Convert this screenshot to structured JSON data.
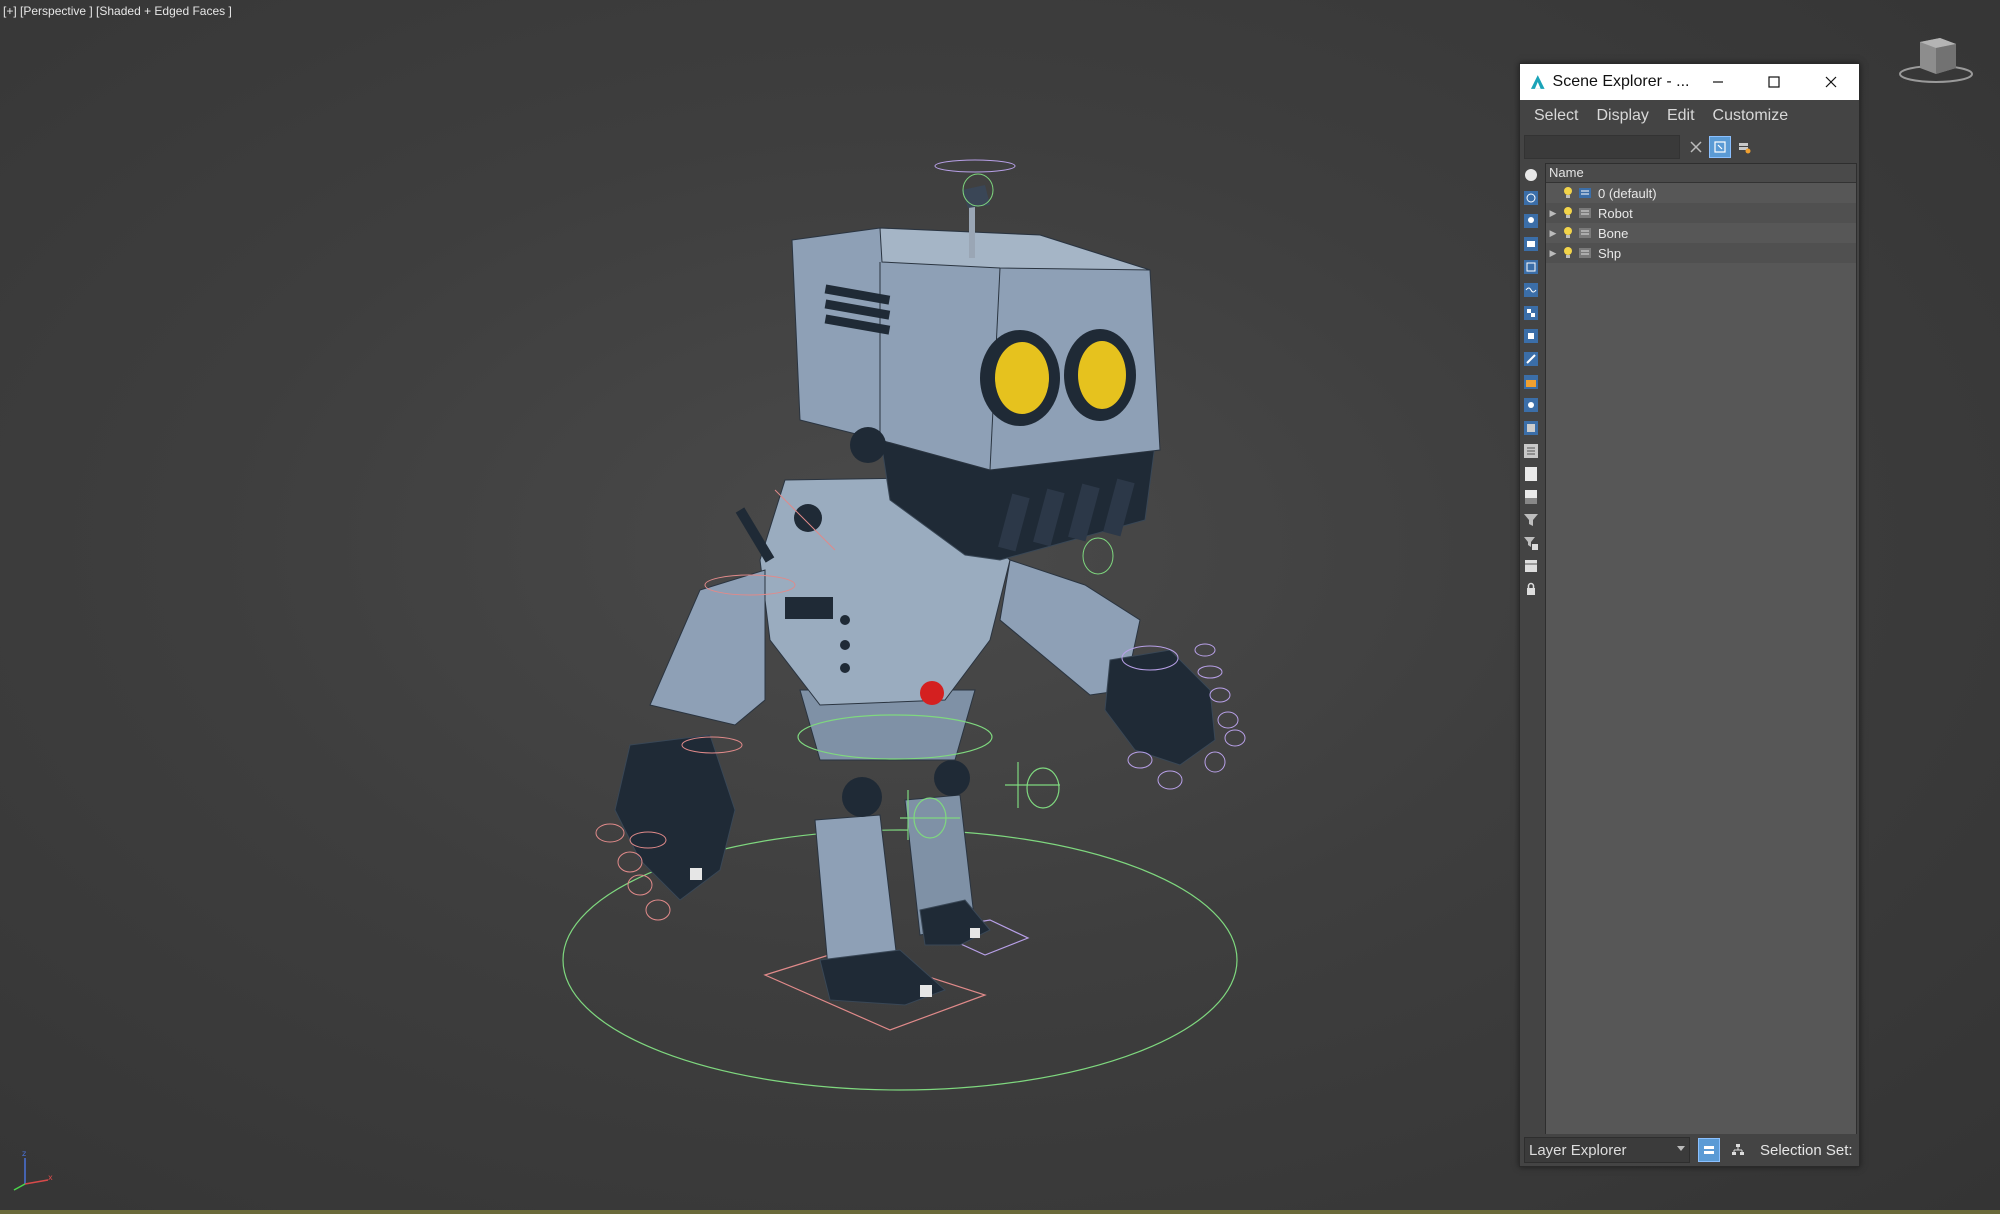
{
  "viewport": {
    "label": "[+] [Perspective ] [Shaded + Edged Faces ]"
  },
  "scene_explorer": {
    "title": "Scene Explorer - ...",
    "menu": [
      "Select",
      "Display",
      "Edit",
      "Customize"
    ],
    "search_value": "",
    "column_header": "Name",
    "layers": [
      {
        "name": "0 (default)",
        "expandable": false
      },
      {
        "name": "Robot",
        "expandable": true
      },
      {
        "name": "Bone",
        "expandable": true
      },
      {
        "name": "Shp",
        "expandable": true
      }
    ],
    "footer": {
      "explorer_type": "Layer Explorer",
      "selection_set_label": "Selection Set:"
    }
  },
  "colors": {
    "viewport_bg": "#3e3e3e",
    "panel_bg": "#444444",
    "tree_bg": "#575757",
    "active_button": "#5b9bd5",
    "helper_green": "#7fd87f",
    "helper_pink": "#e08a8a",
    "helper_purple": "#b8a0e8",
    "robot_body": "#8ea0b6",
    "robot_dark": "#1f2a36",
    "eye_yellow": "#e6c21e",
    "chest_red": "#d42020"
  }
}
